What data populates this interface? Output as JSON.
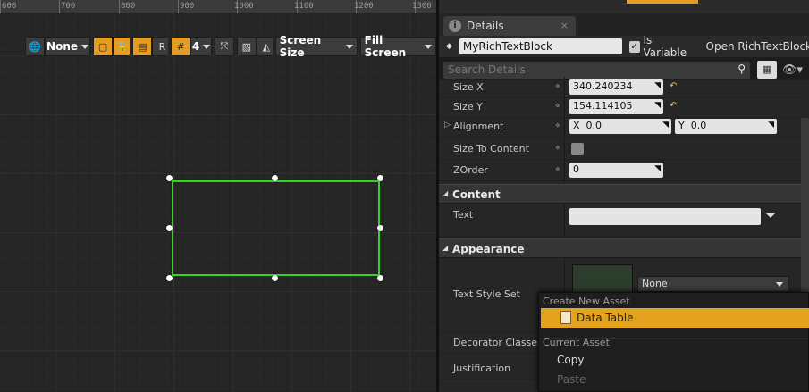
{
  "ruler": {
    "labels": [
      "600",
      "700",
      "800",
      "900",
      "1000",
      "1100",
      "1200",
      "1300"
    ]
  },
  "viewport_toolbar": {
    "localization_icon": "globe-icon",
    "none_dropdown": "None",
    "r_button": "R",
    "grid_snap_value": "4",
    "screen_size_dropdown": "Screen Size",
    "fill_screen_dropdown": "Fill Screen"
  },
  "details": {
    "tab_title": "Details",
    "tab_close": "×",
    "widget_name": "MyRichTextBlock",
    "is_variable_label": "Is Variable",
    "is_variable_checked": true,
    "open_button": "Open RichTextBlock",
    "search_placeholder": "Search Details",
    "properties": {
      "size_x_label": "Size X",
      "size_x_value": "340.240234",
      "size_y_label": "Size Y",
      "size_y_value": "154.114105",
      "alignment_label": "Alignment",
      "alignment_x_prefix": "X",
      "alignment_x_value": "0.0",
      "alignment_y_prefix": "Y",
      "alignment_y_value": "0.0",
      "size_to_content_label": "Size To Content",
      "zorder_label": "ZOrder",
      "zorder_value": "0"
    },
    "content_section": {
      "title": "Content",
      "text_label": "Text",
      "text_value": ""
    },
    "appearance_section": {
      "title": "Appearance",
      "text_style_set_label": "Text Style Set",
      "text_style_set_value": "None",
      "decorator_classes_label": "Decorator Classes",
      "justification_label": "Justification"
    }
  },
  "popup_menu": {
    "create_header": "Create New Asset",
    "data_table_item": "Data Table",
    "current_header": "Current Asset",
    "copy_item": "Copy",
    "paste_item": "Paste"
  },
  "colors": {
    "accent_orange": "#e5a41f",
    "selection_green": "#3ad02a"
  }
}
